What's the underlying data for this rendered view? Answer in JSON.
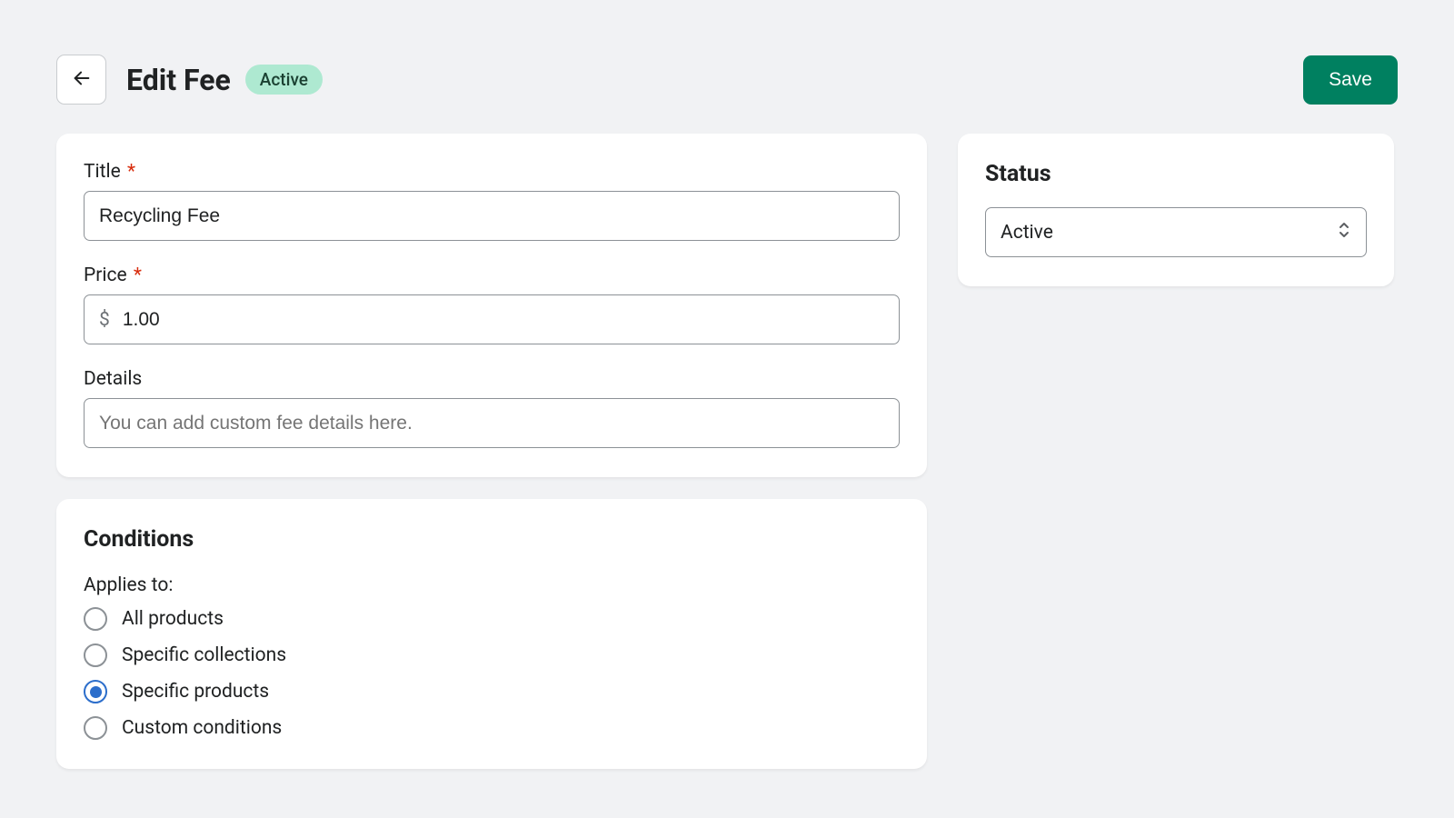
{
  "header": {
    "title": "Edit Fee",
    "badge": "Active",
    "save_label": "Save"
  },
  "form": {
    "title_label": "Title",
    "title_value": "Recycling Fee",
    "price_label": "Price",
    "price_currency": "$",
    "price_value": "1.00",
    "details_label": "Details",
    "details_placeholder": "You can add custom fee details here.",
    "details_value": ""
  },
  "conditions": {
    "section_title": "Conditions",
    "applies_label": "Applies to:",
    "options": [
      {
        "label": "All products",
        "selected": false
      },
      {
        "label": "Specific collections",
        "selected": false
      },
      {
        "label": "Specific products",
        "selected": true
      },
      {
        "label": "Custom conditions",
        "selected": false
      }
    ]
  },
  "status": {
    "section_title": "Status",
    "value": "Active"
  }
}
